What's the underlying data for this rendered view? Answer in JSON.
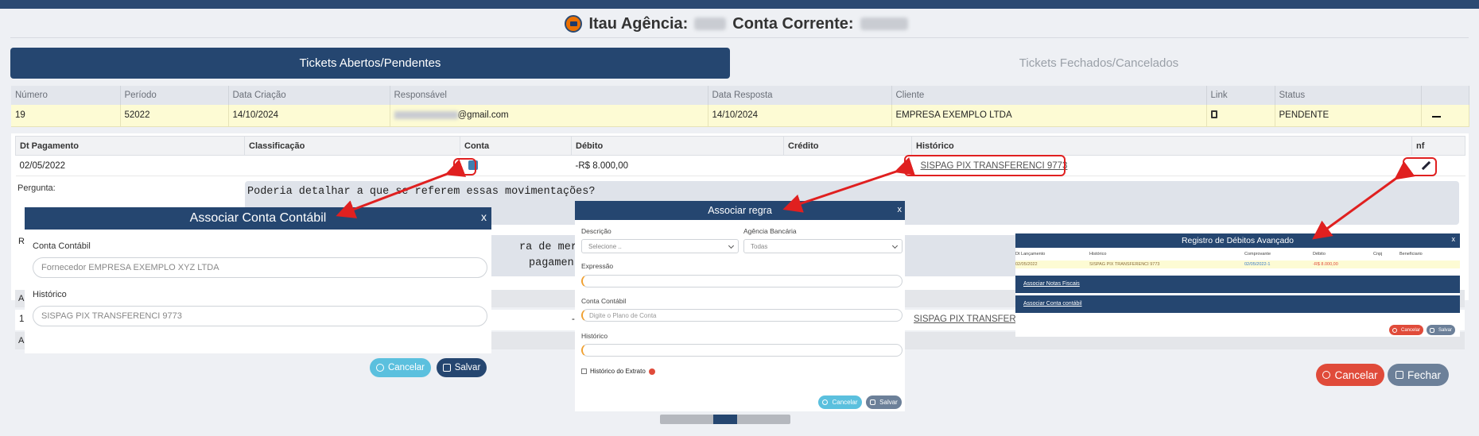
{
  "header": {
    "bank_label": "Itau Agência:",
    "account_label": "Conta Corrente:"
  },
  "tabs": {
    "open": "Tickets Abertos/Pendentes",
    "closed": "Tickets Fechados/Cancelados"
  },
  "tickets_table": {
    "headers": [
      "Número",
      "Período",
      "Data Criação",
      "Responsável",
      "Data Resposta",
      "Cliente",
      "Link",
      "Status",
      ""
    ],
    "row": {
      "numero": "19",
      "periodo": "52022",
      "data_criacao": "14/10/2024",
      "responsavel_suffix": "@gmail.com",
      "data_resposta": "14/10/2024",
      "cliente": "EMPRESA EXEMPLO LTDA",
      "status": "PENDENTE"
    }
  },
  "detail_table": {
    "headers": [
      "Dt Pagamento",
      "Classificação",
      "Conta",
      "Débito",
      "Crédito",
      "Histórico",
      "nf"
    ],
    "row": {
      "dt_pagamento": "02/05/2022",
      "debito": "-R$ 8.000,00",
      "historico": "SISPAG PIX TRANSFERENCI 9773"
    }
  },
  "question": {
    "label": "Pergunta:",
    "text": "Poderia detalhar a que se referem essas movimentações?"
  },
  "response": {
    "label": "R",
    "line1": "ra de mercador",
    "line2": "pagamento."
  },
  "partial": {
    "a1": "A",
    "row2_num": "1",
    "row2_deb": "-",
    "row2_hist": "SISPAG PIX TRANSFERI",
    "a2": "A"
  },
  "modal_conta": {
    "title": "Associar Conta Contábil",
    "close": "x",
    "conta_label": "Conta Contábil",
    "conta_value": "Fornecedor EMPRESA EXEMPLO XYZ LTDA",
    "historico_label": "Histórico",
    "historico_value": "SISPAG PIX TRANSFERENCI 9773",
    "cancel": "Cancelar",
    "save": "Salvar"
  },
  "modal_regra": {
    "title": "Associar regra",
    "close": "x",
    "descricao_label": "Descrição",
    "descricao_placeholder": "Selecione ..",
    "agencia_label": "Agência Bancária",
    "agencia_value": "Todas",
    "expressao_label": "Expressão",
    "conta_label": "Conta Contábil",
    "conta_placeholder": "Digite o Plano de Conta",
    "historico_label": "Histórico",
    "checkbox_label": "Histórico do Extrato",
    "cancel": "Cancelar",
    "save": "Salvar"
  },
  "modal_debitos": {
    "title": "Registro de Débitos Avançado",
    "close": "x",
    "headers": [
      "Dt Lançamento",
      "Histórico",
      "Comprovante",
      "Débito",
      "Cnpj",
      "Beneficiario"
    ],
    "row": {
      "dt": "02/05/2022",
      "hist": "SISPAG PIX TRANSFERENCI 9773",
      "comprovante": "02/05/2022-1",
      "debito": "-R$ 8.000,00"
    },
    "link_nf": "Associar Notas Fiscais",
    "link_conta": "Associar Conta contábil",
    "cancel": "Cancelar",
    "save": "Salvar"
  },
  "footer": {
    "cancel": "Cancelar",
    "close": "Fechar"
  },
  "colors": {
    "primary": "#254670",
    "danger": "#e04b3a",
    "info": "#5bc0de",
    "highlight": "#fdfbd4",
    "annotation": "#e02020"
  }
}
